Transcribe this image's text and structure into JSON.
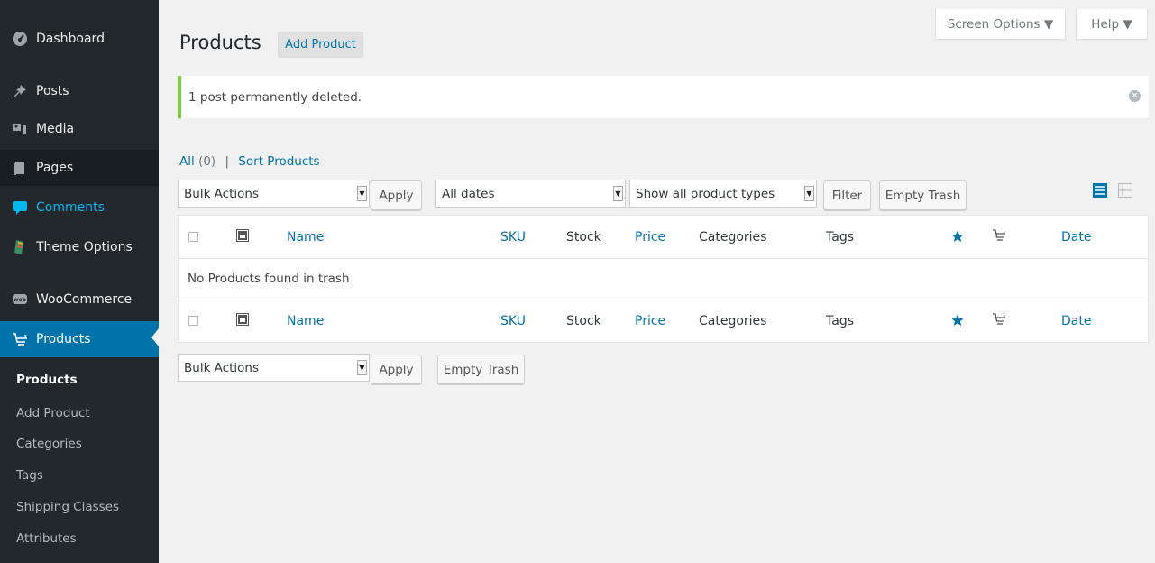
{
  "sidebar": {
    "items": [
      {
        "label": "Dashboard",
        "icon": "dashboard-icon"
      },
      {
        "label": "Posts",
        "icon": "pin-icon"
      },
      {
        "label": "Media",
        "icon": "media-icon"
      },
      {
        "label": "Pages",
        "icon": "pages-icon"
      },
      {
        "label": "Comments",
        "icon": "comments-icon"
      },
      {
        "label": "Theme Options",
        "icon": "theme-options-icon"
      },
      {
        "label": "WooCommerce",
        "icon": "woocommerce-icon"
      },
      {
        "label": "Products",
        "icon": "cart-icon"
      }
    ],
    "submenu": [
      "Products",
      "Add Product",
      "Categories",
      "Tags",
      "Shipping Classes",
      "Attributes"
    ]
  },
  "screen_meta": {
    "screen_options": "Screen Options ▼",
    "help": "Help ▼"
  },
  "header": {
    "title": "Products",
    "add_button": "Add Product"
  },
  "notice": {
    "message": "1 post permanently deleted."
  },
  "views": {
    "all_label": "All",
    "all_count": "(0)",
    "separator": "|",
    "sort_label": "Sort Products"
  },
  "top_nav": {
    "bulk_actions": "Bulk Actions",
    "apply": "Apply",
    "dates": "All dates",
    "product_types": "Show all product types",
    "filter": "Filter",
    "empty_trash": "Empty Trash"
  },
  "table": {
    "columns": {
      "name": "Name",
      "sku": "SKU",
      "stock": "Stock",
      "price": "Price",
      "categories": "Categories",
      "tags": "Tags",
      "date": "Date"
    },
    "empty_message": "No Products found in trash"
  },
  "bottom_nav": {
    "bulk_actions": "Bulk Actions",
    "apply": "Apply",
    "empty_trash": "Empty Trash"
  },
  "colors": {
    "sidebar_bg": "#23282d",
    "active_bg": "#0073aa",
    "link": "#0073aa",
    "notice_border": "#7ad03a"
  }
}
